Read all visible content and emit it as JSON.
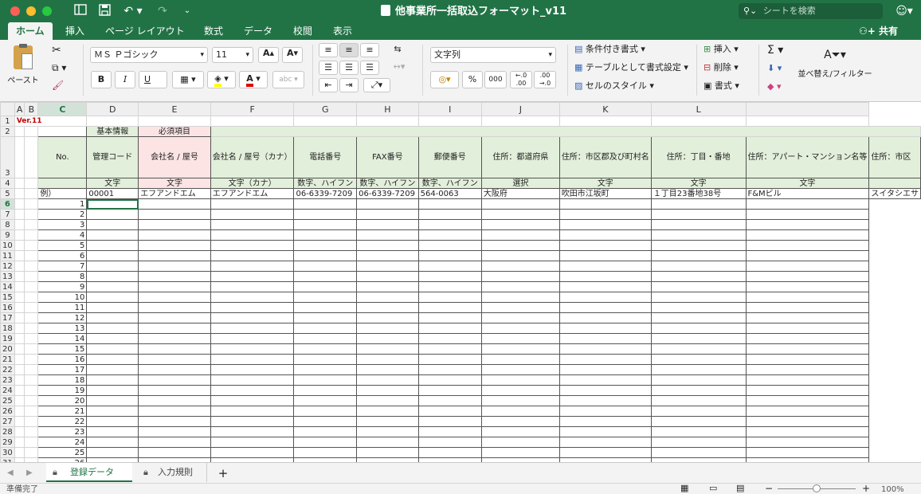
{
  "window": {
    "title": "他事業所一括取込フォーマット_v11",
    "search_placeholder": "シートを検索"
  },
  "ribbon_tabs": [
    "ホーム",
    "挿入",
    "ページ レイアウト",
    "数式",
    "データ",
    "校閲",
    "表示"
  ],
  "share_label": "共有",
  "ribbon": {
    "paste_label": "ペースト",
    "font_name": "ＭＳ Ｐゴシック",
    "font_size": "11",
    "bold": "B",
    "italic": "I",
    "underline": "U",
    "number_format": "文字列",
    "percent": "%",
    "thousands": "000",
    "conditional_format": "条件付き書式",
    "format_as_table": "テーブルとして書式設定",
    "cell_styles": "セルのスタイル",
    "insert": "挿入",
    "delete": "削除",
    "format": "書式",
    "sort_filter": "並べ替え/フィルター"
  },
  "columns": [
    "A",
    "B",
    "C",
    "D",
    "E",
    "F",
    "G",
    "H",
    "I",
    "J",
    "K",
    "L"
  ],
  "sheet": {
    "version": "Ver.11",
    "group_basic": "基本情報",
    "group_required": "必須項目",
    "no_label": "No.",
    "headers": [
      "管理コード",
      "会社名 / 屋号",
      "会社名 / 屋号（カナ）",
      "電話番号",
      "FAX番号",
      "郵便番号",
      "住所：都道府県",
      "住所：市区郡及び町村名",
      "住所：丁目・番地",
      "住所：アパート・マンション名等",
      "住所：市区"
    ],
    "types": [
      "文字",
      "文字",
      "文字（カナ）",
      "数字、ハイフン",
      "数字、ハイフン",
      "数字、ハイフン",
      "選択",
      "文字",
      "文字",
      "文字",
      ""
    ],
    "example_label": "例）",
    "example": [
      "00001",
      "エフアンドエム",
      "エフアンドエム",
      "06-6339-7209",
      "06-6339-7209",
      "564-0063",
      "大阪府",
      "吹田市江坂町",
      "１丁目23番地38号",
      "F&Mビル",
      "スイタシエサ"
    ]
  },
  "sheet_tabs": [
    {
      "label": "登録データ",
      "active": true
    },
    {
      "label": "入力規則",
      "active": false
    }
  ],
  "status": {
    "ready": "準備完了",
    "zoom": "100%"
  }
}
